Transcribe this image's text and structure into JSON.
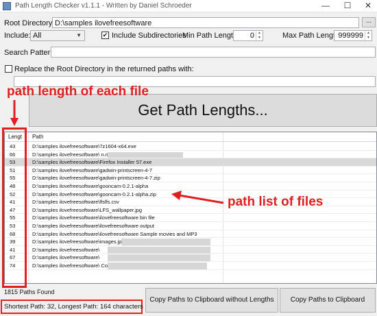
{
  "window": {
    "title": "Path Length Checker v1.1.1 - Written by Daniel Schroeder",
    "min_icon": "minimize-icon",
    "max_icon": "maximize-icon",
    "close_icon": "close-icon"
  },
  "form": {
    "root_label": "Root Directory:",
    "root_value": "D:\\samples ilovefreesoftware",
    "browse_label": "...",
    "include_label": "Include:",
    "include_value": "All",
    "subdirs_label": "Include Subdirectories",
    "subdirs_checked": true,
    "min_label": "Min Path Length:",
    "min_value": "0",
    "max_label": "Max Path Length:",
    "max_value": "999999",
    "search_label": "Search Pattern:",
    "search_value": "",
    "replace_label": "Replace the Root Directory in the returned paths with:",
    "replace_checked": false,
    "replace_value": ""
  },
  "get_button_label": "Get Path Lengths...",
  "grid": {
    "col_length": "Lengt",
    "col_path": "Path",
    "rows": [
      {
        "len": "43",
        "path": "D:\\samples ilovefreesoftware\\7z1604-x64.exe"
      },
      {
        "len": "66",
        "path": "D:\\samples ilovefreesoftware\\                                                    n.mkv"
      },
      {
        "len": "53",
        "path": "D:\\samples ilovefreesoftware\\Firefox Installer 57.exe"
      },
      {
        "len": "51",
        "path": "D:\\samples ilovefreesoftware\\gadwin-printscreen-4-7"
      },
      {
        "len": "55",
        "path": "D:\\samples ilovefreesoftware\\gadwin-printscreen-4-7.zip"
      },
      {
        "len": "48",
        "path": "D:\\samples ilovefreesoftware\\gooncam-0.2.1-alpha"
      },
      {
        "len": "52",
        "path": "D:\\samples ilovefreesoftware\\gooncam-0.2.1-alpha.zip"
      },
      {
        "len": "41",
        "path": "D:\\samples ilovefreesoftware\\lfslfs.csv"
      },
      {
        "len": "47",
        "path": "D:\\samples ilovefreesoftware\\LFS_wallpaper.jpg"
      },
      {
        "len": "55",
        "path": "D:\\samples ilovefreesoftware\\ilovefreesoftware bin file"
      },
      {
        "len": "53",
        "path": "D:\\samples ilovefreesoftware\\ilovefreesoftware output"
      },
      {
        "len": "68",
        "path": "D:\\samples ilovefreesoftware\\ilovefreesoftware Sample movies and MP3"
      },
      {
        "len": "39",
        "path": "D:\\samples ilovefreesoftware\\images.jpg"
      },
      {
        "len": "41",
        "path": "D:\\samples ilovefreesoftware\\"
      },
      {
        "len": "67",
        "path": "D:\\samples ilovefreesoftware\\"
      },
      {
        "len": "74",
        "path": "D:\\samples ilovefreesoftware\\                                                                   Copy"
      }
    ]
  },
  "status": {
    "found": "1815 Paths Found",
    "summary": "Shortest Path: 32, Longest Path: 164 characters"
  },
  "buttons": {
    "copy_without": "Copy Paths to Clipboard without Lengths",
    "copy_with": "Copy Paths to Clipboard"
  },
  "annotations": {
    "length_note": "path length of each file",
    "list_note": "path list of files",
    "color": "#e02020"
  }
}
